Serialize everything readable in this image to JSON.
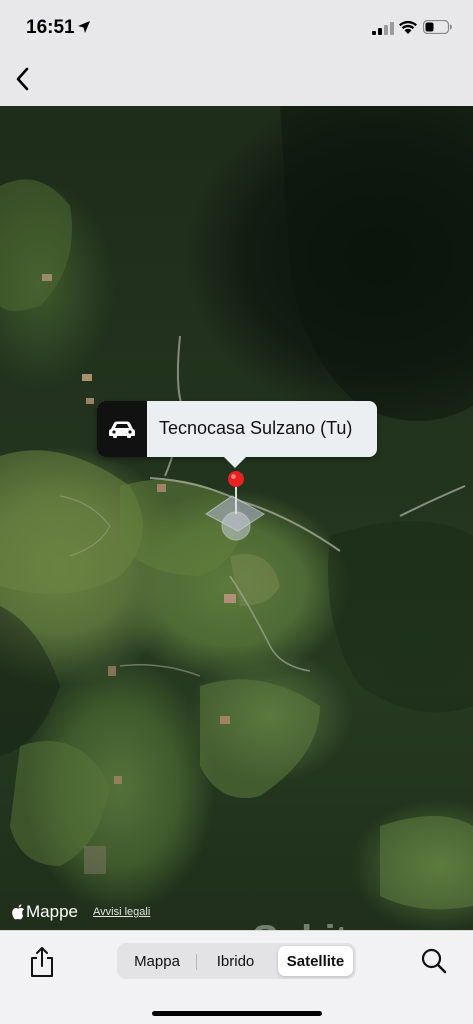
{
  "status_bar": {
    "time": "16:51",
    "icons": [
      "location-arrow-icon",
      "cellular-signal-icon",
      "wifi-icon",
      "battery-icon"
    ]
  },
  "nav": {
    "back_icon": "chevron-left-icon"
  },
  "map": {
    "imagery": "satellite",
    "callout": {
      "icon": "car-icon",
      "label": "Tecnocasa Sulzano (Tu)"
    },
    "pin_icon": "red-map-pin",
    "attribution": {
      "brand": "Mappe",
      "legal_link": "Avvisi legali"
    },
    "watermark": "Subito"
  },
  "toolbar": {
    "share_icon": "share-icon",
    "segments": [
      {
        "label": "Mappa",
        "selected": false
      },
      {
        "label": "Ibrido",
        "selected": false
      },
      {
        "label": "Satellite",
        "selected": true
      }
    ],
    "search_icon": "search-icon"
  },
  "colors": {
    "pin": "#e82222",
    "callout_bg": "#eceff1",
    "callout_icon_bg": "#111111"
  }
}
